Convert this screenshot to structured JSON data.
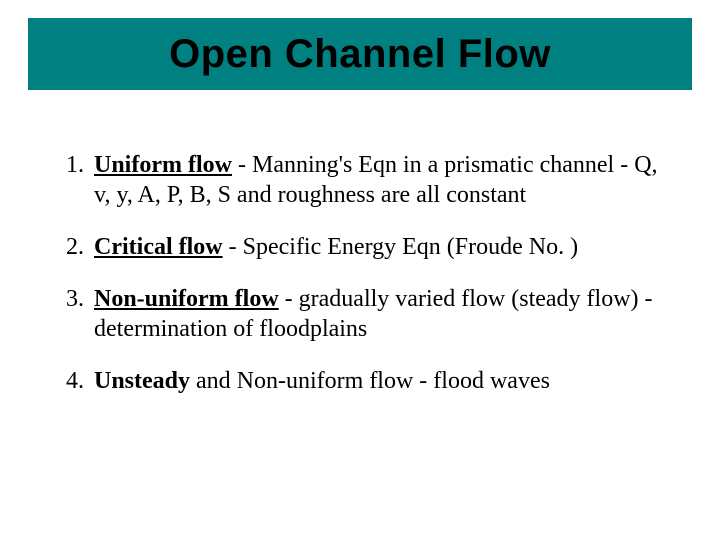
{
  "title": "Open Channel Flow",
  "items": [
    {
      "term": "Uniform flow",
      "rest": " - Manning's Eqn in a prismatic channel - Q, v, y, A, P, B, S and roughness are all constant"
    },
    {
      "term": "Critical flow",
      "rest": " - Specific Energy Eqn (Froude No. )"
    },
    {
      "term": "Non-uniform flow",
      "rest": " - gradually varied flow (steady flow) - determination of floodplains"
    },
    {
      "lead": "Unsteady",
      "rest": " and Non-uniform flow - flood waves"
    }
  ]
}
